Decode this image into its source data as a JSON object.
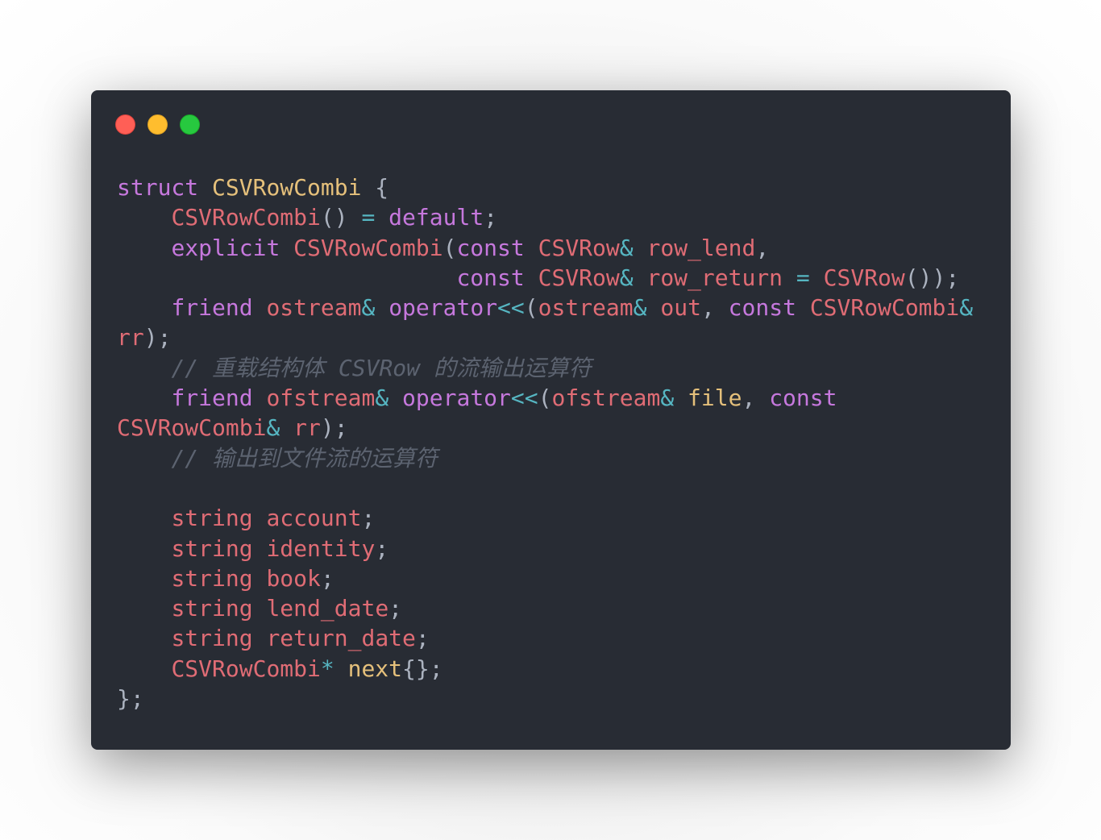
{
  "window": {
    "buttons": {
      "close_color": "#ff5f56",
      "minimize_color": "#ffbd2e",
      "maximize_color": "#27c93f"
    },
    "background_color": "#282c34"
  },
  "theme": {
    "keyword": "#c678dd",
    "type": "#e5c07b",
    "identifier": "#e06c75",
    "operator": "#56b6c2",
    "punctuation": "#abb2bf",
    "comment": "#5c6370"
  },
  "code": {
    "lines": [
      [
        [
          "kw",
          "struct"
        ],
        [
          "pu",
          " "
        ],
        [
          "ty",
          "CSVRowCombi"
        ],
        [
          "pu",
          " {"
        ]
      ],
      [
        [
          "pu",
          "    "
        ],
        [
          "rd",
          "CSVRowCombi"
        ],
        [
          "pu",
          "() "
        ],
        [
          "op",
          "="
        ],
        [
          "pu",
          " "
        ],
        [
          "kw",
          "default"
        ],
        [
          "pu",
          ";"
        ]
      ],
      [
        [
          "pu",
          "    "
        ],
        [
          "kw",
          "explicit"
        ],
        [
          "pu",
          " "
        ],
        [
          "rd",
          "CSVRowCombi"
        ],
        [
          "pu",
          "("
        ],
        [
          "kw",
          "const"
        ],
        [
          "pu",
          " "
        ],
        [
          "rd",
          "CSVRow"
        ],
        [
          "op",
          "&"
        ],
        [
          "pu",
          " "
        ],
        [
          "rd",
          "row_lend"
        ],
        [
          "pu",
          ","
        ]
      ],
      [
        [
          "pu",
          "                         "
        ],
        [
          "kw",
          "const"
        ],
        [
          "pu",
          " "
        ],
        [
          "rd",
          "CSVRow"
        ],
        [
          "op",
          "&"
        ],
        [
          "pu",
          " "
        ],
        [
          "rd",
          "row_return"
        ],
        [
          "pu",
          " "
        ],
        [
          "op",
          "="
        ],
        [
          "pu",
          " "
        ],
        [
          "rd",
          "CSVRow"
        ],
        [
          "pu",
          "());"
        ]
      ],
      [
        [
          "pu",
          "    "
        ],
        [
          "kw",
          "friend"
        ],
        [
          "pu",
          " "
        ],
        [
          "rd",
          "ostream"
        ],
        [
          "op",
          "&"
        ],
        [
          "pu",
          " "
        ],
        [
          "kw",
          "operator"
        ],
        [
          "op",
          "<<"
        ],
        [
          "pu",
          "("
        ],
        [
          "rd",
          "ostream"
        ],
        [
          "op",
          "&"
        ],
        [
          "pu",
          " "
        ],
        [
          "rd",
          "out"
        ],
        [
          "pu",
          ", "
        ],
        [
          "kw",
          "const"
        ],
        [
          "pu",
          " "
        ],
        [
          "rd",
          "CSVRowCombi"
        ],
        [
          "op",
          "&"
        ]
      ],
      [
        [
          "rd",
          "rr"
        ],
        [
          "pu",
          ");"
        ]
      ],
      [
        [
          "pu",
          "    "
        ],
        [
          "cm",
          "// 重载结构体 CSVRow 的流输出运算符"
        ]
      ],
      [
        [
          "pu",
          "    "
        ],
        [
          "kw",
          "friend"
        ],
        [
          "pu",
          " "
        ],
        [
          "rd",
          "ofstream"
        ],
        [
          "op",
          "&"
        ],
        [
          "pu",
          " "
        ],
        [
          "kw",
          "operator"
        ],
        [
          "op",
          "<<"
        ],
        [
          "pu",
          "("
        ],
        [
          "rd",
          "ofstream"
        ],
        [
          "op",
          "&"
        ],
        [
          "pu",
          " "
        ],
        [
          "ty",
          "file"
        ],
        [
          "pu",
          ", "
        ],
        [
          "kw",
          "const"
        ]
      ],
      [
        [
          "rd",
          "CSVRowCombi"
        ],
        [
          "op",
          "&"
        ],
        [
          "pu",
          " "
        ],
        [
          "rd",
          "rr"
        ],
        [
          "pu",
          ");"
        ]
      ],
      [
        [
          "pu",
          "    "
        ],
        [
          "cm",
          "// 输出到文件流的运算符"
        ]
      ],
      [
        [
          "pu",
          ""
        ]
      ],
      [
        [
          "pu",
          "    "
        ],
        [
          "rd",
          "string"
        ],
        [
          "pu",
          " "
        ],
        [
          "rd",
          "account"
        ],
        [
          "pu",
          ";"
        ]
      ],
      [
        [
          "pu",
          "    "
        ],
        [
          "rd",
          "string"
        ],
        [
          "pu",
          " "
        ],
        [
          "rd",
          "identity"
        ],
        [
          "pu",
          ";"
        ]
      ],
      [
        [
          "pu",
          "    "
        ],
        [
          "rd",
          "string"
        ],
        [
          "pu",
          " "
        ],
        [
          "rd",
          "book"
        ],
        [
          "pu",
          ";"
        ]
      ],
      [
        [
          "pu",
          "    "
        ],
        [
          "rd",
          "string"
        ],
        [
          "pu",
          " "
        ],
        [
          "rd",
          "lend_date"
        ],
        [
          "pu",
          ";"
        ]
      ],
      [
        [
          "pu",
          "    "
        ],
        [
          "rd",
          "string"
        ],
        [
          "pu",
          " "
        ],
        [
          "rd",
          "return_date"
        ],
        [
          "pu",
          ";"
        ]
      ],
      [
        [
          "pu",
          "    "
        ],
        [
          "rd",
          "CSVRowCombi"
        ],
        [
          "op",
          "*"
        ],
        [
          "pu",
          " "
        ],
        [
          "ty",
          "next"
        ],
        [
          "pu",
          "{};"
        ]
      ],
      [
        [
          "pu",
          "};"
        ]
      ]
    ]
  }
}
